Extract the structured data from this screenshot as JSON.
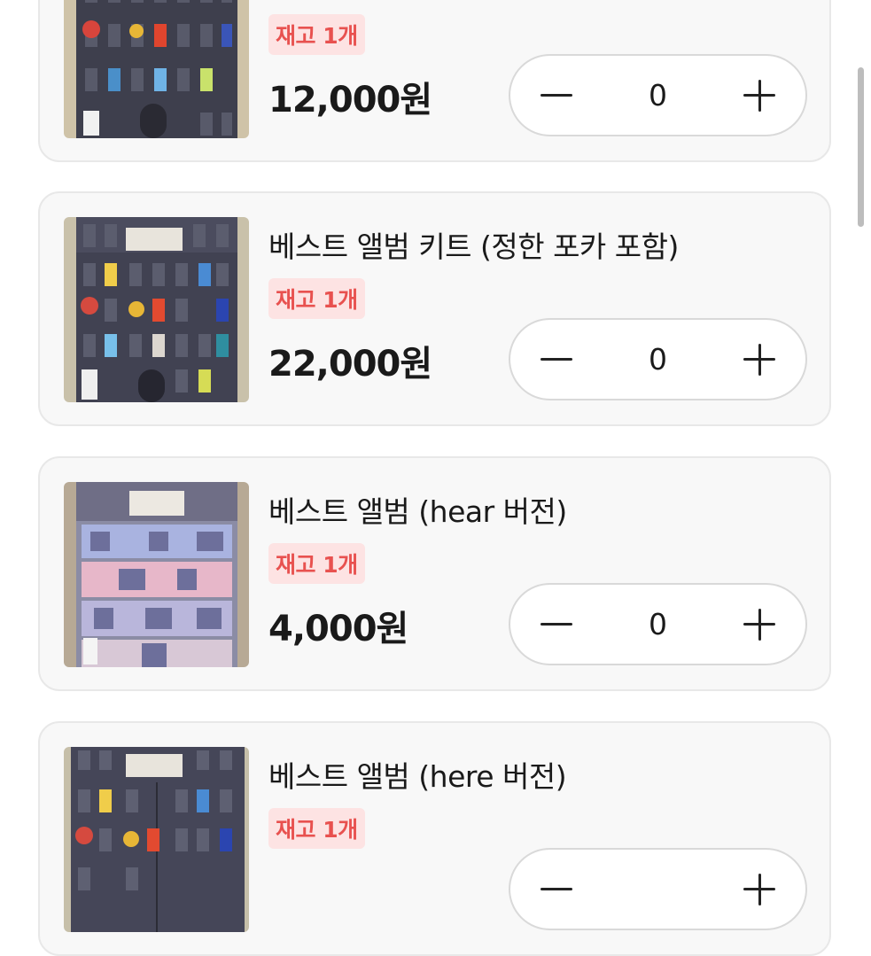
{
  "products": [
    {
      "title": "",
      "stock_label": "재고 1개",
      "price": "12,000원",
      "quantity": "0",
      "image": "building-night"
    },
    {
      "title": "베스트 앨범 키트 (정한 포카 포함)",
      "stock_label": "재고 1개",
      "price": "22,000원",
      "quantity": "0",
      "image": "building-night"
    },
    {
      "title": "베스트 앨범 (hear 버전)",
      "stock_label": "재고 1개",
      "price": "4,000원",
      "quantity": "0",
      "image": "building-pastel"
    },
    {
      "title": "베스트 앨범 (here 버전)",
      "stock_label": "재고 1개",
      "price": "",
      "quantity": "",
      "image": "building-night"
    }
  ],
  "icons": {
    "decrease": "minus-icon",
    "increase": "plus-icon"
  },
  "colors": {
    "stock_badge_bg": "#fde3e3",
    "stock_badge_text": "#e8514f",
    "card_bg": "#f8f8f8"
  }
}
